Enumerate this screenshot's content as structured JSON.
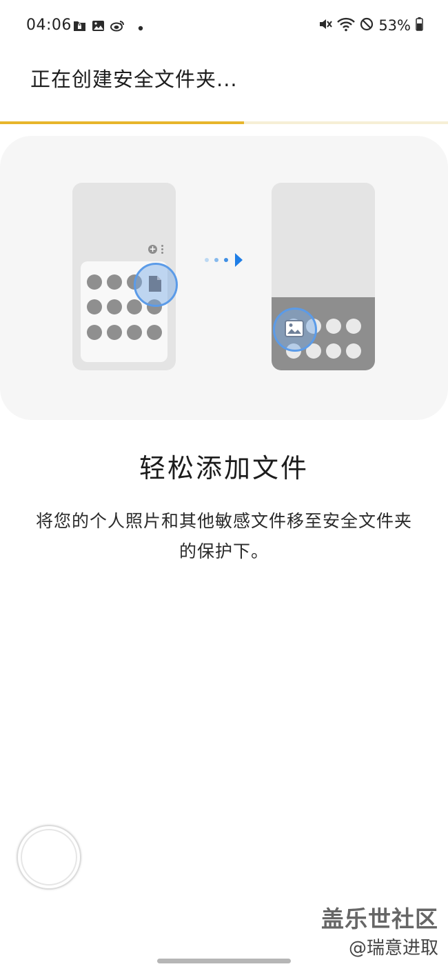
{
  "status_bar": {
    "time": "04:06",
    "battery": "53%",
    "left_icons": [
      "folder-lock-icon",
      "gallery-icon",
      "weibo-icon",
      "notification-dot-icon"
    ],
    "right_icons": [
      "mute-icon",
      "wifi-icon",
      "do-not-disturb-icon",
      "battery-icon"
    ]
  },
  "header": {
    "title": "正在创建安全文件夹..."
  },
  "progress": {
    "value": 0.545,
    "color": "#e7b52c"
  },
  "illustration": {
    "left_icon": "document-icon",
    "right_icon": "image-icon",
    "arrow_icon": "arrow-right-icon",
    "accent": "#5b9be8"
  },
  "content": {
    "title": "轻松添加文件",
    "description": "将您的个人照片和其他敏感文件移至安全文件夹的保护下。"
  },
  "watermark": {
    "logo": "盖乐世社区",
    "user": "@瑞意进取"
  }
}
